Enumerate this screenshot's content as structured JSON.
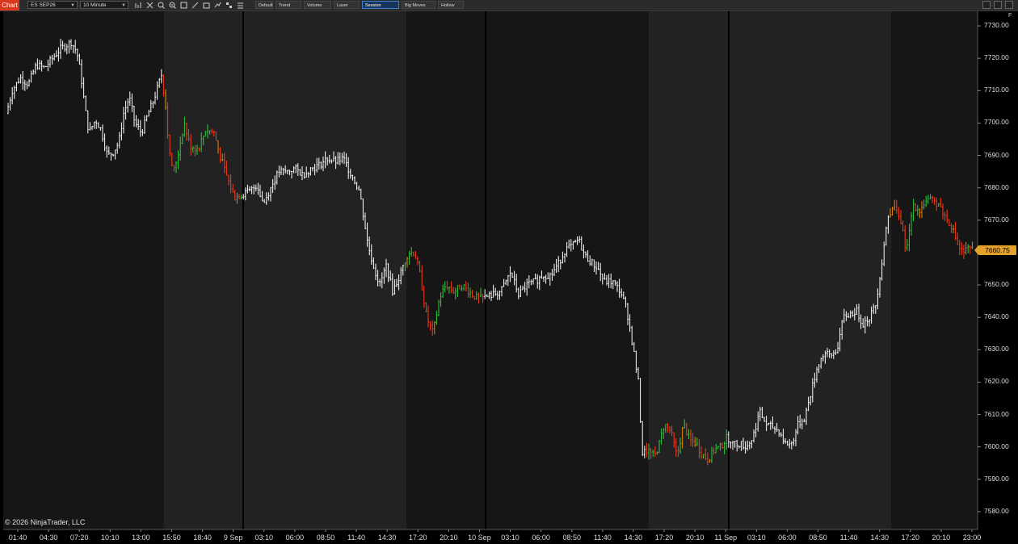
{
  "toolbar": {
    "chart_tab": "Chart",
    "instrument": "ES SEP26",
    "interval": "10 Minute",
    "icons": [
      "bars-icon",
      "crosshair-icon",
      "zoom-in-icon",
      "zoom-out-icon",
      "properties-icon",
      "drawing-tool-icon",
      "strategies-icon",
      "indicators-icon",
      "templates-icon",
      "data-box-icon"
    ],
    "buttons": [
      {
        "label": "Default",
        "active": false
      },
      {
        "label": "Trend Rider",
        "active": false
      },
      {
        "label": "Volume Bars",
        "active": false
      },
      {
        "label": "Laser Focus",
        "active": false
      },
      {
        "label": "Session Highlight",
        "active": true
      },
      {
        "label": "Big Moves Only",
        "active": false
      },
      {
        "label": "Hollow Bars",
        "active": false
      }
    ]
  },
  "copyright": "© 2026 NinjaTrader, LLC",
  "f_marker": "F",
  "last_price": "7660.75",
  "colors": {
    "background": "#000000",
    "session_band_a": "#161616",
    "session_band_b": "#222222",
    "bar_neutral": "#ffffff",
    "bar_up": "#2ecc40",
    "bar_down": "#ff3a1a",
    "bar_orange": "#e68a00",
    "last_price_marker": "#e3a12b"
  },
  "chart_data": {
    "type": "ohlc-bar",
    "instrument": "ES SEP26",
    "interval": "10 Minute",
    "y_range": [
      7575,
      7735
    ],
    "y_ticks": [
      "7730.00",
      "7720.00",
      "7710.00",
      "7700.00",
      "7690.00",
      "7680.00",
      "7670.00",
      "7660.00",
      "7650.00",
      "7640.00",
      "7630.00",
      "7620.00",
      "7610.00",
      "7600.00",
      "7590.00",
      "7580.00"
    ],
    "x_ticks": [
      "01:40",
      "04:30",
      "07:20",
      "10:10",
      "13:00",
      "15:50",
      "18:40",
      "9 Sep",
      "03:10",
      "06:00",
      "08:50",
      "11:40",
      "14:30",
      "17:20",
      "20:10",
      "10 Sep",
      "03:10",
      "06:00",
      "08:50",
      "11:40",
      "14:30",
      "17:20",
      "20:10",
      "11 Sep",
      "03:10",
      "06:00",
      "08:50",
      "11:40",
      "14:30",
      "17:20",
      "20:10",
      "23:00"
    ],
    "price_path": [
      [
        0,
        7705
      ],
      [
        8,
        7703
      ],
      [
        15,
        7710
      ],
      [
        25,
        7714
      ],
      [
        35,
        7712
      ],
      [
        45,
        7718
      ],
      [
        55,
        7717
      ],
      [
        65,
        7720
      ],
      [
        75,
        7723
      ],
      [
        88,
        7725
      ],
      [
        95,
        7722
      ],
      [
        100,
        7715
      ],
      [
        105,
        7705
      ],
      [
        110,
        7697
      ],
      [
        118,
        7701
      ],
      [
        125,
        7698
      ],
      [
        133,
        7690
      ],
      [
        140,
        7691
      ],
      [
        147,
        7694
      ],
      [
        153,
        7703
      ],
      [
        160,
        7708
      ],
      [
        167,
        7700
      ],
      [
        175,
        7697
      ],
      [
        182,
        7702
      ],
      [
        190,
        7707
      ],
      [
        200,
        7715
      ],
      [
        205,
        7705
      ],
      [
        210,
        7690
      ],
      [
        215,
        7685
      ],
      [
        220,
        7690
      ],
      [
        228,
        7700
      ],
      [
        235,
        7693
      ],
      [
        245,
        7692
      ],
      [
        255,
        7698
      ],
      [
        265,
        7697
      ],
      [
        272,
        7690
      ],
      [
        280,
        7684
      ],
      [
        290,
        7677
      ],
      [
        300,
        7678
      ],
      [
        310,
        7679
      ],
      [
        318,
        7681
      ],
      [
        326,
        7675
      ],
      [
        335,
        7680
      ],
      [
        345,
        7685
      ],
      [
        355,
        7685
      ],
      [
        365,
        7686
      ],
      [
        375,
        7684
      ],
      [
        385,
        7686
      ],
      [
        395,
        7687
      ],
      [
        405,
        7689
      ],
      [
        415,
        7688
      ],
      [
        425,
        7689
      ],
      [
        435,
        7684
      ],
      [
        445,
        7679
      ],
      [
        455,
        7663
      ],
      [
        462,
        7656
      ],
      [
        470,
        7650
      ],
      [
        478,
        7656
      ],
      [
        486,
        7648
      ],
      [
        495,
        7653
      ],
      [
        505,
        7660
      ],
      [
        513,
        7660
      ],
      [
        520,
        7653
      ],
      [
        528,
        7640
      ],
      [
        536,
        7635
      ],
      [
        544,
        7646
      ],
      [
        552,
        7650
      ],
      [
        562,
        7648
      ],
      [
        572,
        7650
      ],
      [
        580,
        7648
      ],
      [
        590,
        7646
      ],
      [
        598,
        7646
      ],
      [
        610,
        7647
      ],
      [
        620,
        7648
      ],
      [
        632,
        7654
      ],
      [
        642,
        7647
      ],
      [
        652,
        7650
      ],
      [
        662,
        7651
      ],
      [
        672,
        7653
      ],
      [
        682,
        7653
      ],
      [
        692,
        7657
      ],
      [
        700,
        7661
      ],
      [
        708,
        7662
      ],
      [
        716,
        7664
      ],
      [
        724,
        7659
      ],
      [
        732,
        7657
      ],
      [
        740,
        7655
      ],
      [
        748,
        7651
      ],
      [
        758,
        7651
      ],
      [
        768,
        7648
      ],
      [
        776,
        7642
      ],
      [
        784,
        7630
      ],
      [
        790,
        7620
      ],
      [
        795,
        7598
      ],
      [
        802,
        7599
      ],
      [
        810,
        7597
      ],
      [
        816,
        7601
      ],
      [
        822,
        7607
      ],
      [
        830,
        7605
      ],
      [
        838,
        7597
      ],
      [
        846,
        7607
      ],
      [
        854,
        7602
      ],
      [
        862,
        7601
      ],
      [
        868,
        7598
      ],
      [
        876,
        7596
      ],
      [
        884,
        7599
      ],
      [
        892,
        7600
      ],
      [
        900,
        7603
      ],
      [
        908,
        7601
      ],
      [
        916,
        7601
      ],
      [
        924,
        7600
      ],
      [
        932,
        7603
      ],
      [
        940,
        7611
      ],
      [
        948,
        7607
      ],
      [
        956,
        7606
      ],
      [
        964,
        7605
      ],
      [
        972,
        7601
      ],
      [
        980,
        7601
      ],
      [
        988,
        7607
      ],
      [
        996,
        7609
      ],
      [
        1004,
        7617
      ],
      [
        1012,
        7625
      ],
      [
        1020,
        7629
      ],
      [
        1028,
        7628
      ],
      [
        1036,
        7630
      ],
      [
        1044,
        7640
      ],
      [
        1052,
        7641
      ],
      [
        1060,
        7642
      ],
      [
        1068,
        7638
      ],
      [
        1076,
        7640
      ],
      [
        1084,
        7644
      ],
      [
        1092,
        7658
      ],
      [
        1098,
        7670
      ],
      [
        1104,
        7673
      ],
      [
        1110,
        7674
      ],
      [
        1116,
        7668
      ],
      [
        1122,
        7660
      ],
      [
        1130,
        7675
      ],
      [
        1138,
        7673
      ],
      [
        1146,
        7676
      ],
      [
        1154,
        7676
      ],
      [
        1162,
        7675
      ],
      [
        1170,
        7671
      ],
      [
        1178,
        7668
      ],
      [
        1186,
        7662
      ],
      [
        1192,
        7660
      ],
      [
        1198,
        7661
      ],
      [
        1204,
        7661
      ]
    ],
    "color_segments": [
      [
        200,
        300
      ],
      [
        500,
        600
      ],
      [
        800,
        900
      ],
      [
        1100,
        1210
      ]
    ],
    "session_bands_shade": [
      [
        203,
        503
      ],
      [
        803,
        1103
      ]
    ],
    "session_separators": [
      "9 Sep",
      "10 Sep",
      "11 Sep"
    ],
    "last_value": 7660.75
  }
}
